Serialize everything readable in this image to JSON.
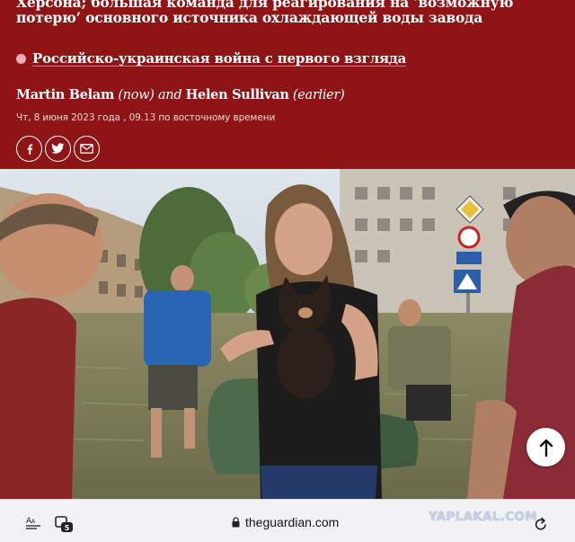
{
  "article": {
    "headline": "Херсона; большая команда для реагирования на ‘возможную потерю’ основного источника охлаждающей воды завода",
    "series_link": "Российско-украинская война с первого взгляда",
    "byline": {
      "author1": "Martin Belam",
      "author1_note": "(now)",
      "conjunction": "and",
      "author2": "Helen Sullivan",
      "author2_note": "(earlier)"
    },
    "dateline": "Чт, 8 июня 2023 года , 09.13 по восточному времени",
    "share": [
      "facebook",
      "twitter",
      "email"
    ]
  },
  "browser": {
    "url": "theguardian.com",
    "tab_count": "5",
    "watermark": "YAPLAKAL.COM"
  },
  "colors": {
    "header_bg": "#8f1416",
    "series_dot": "#f4a9b8",
    "browser_bg": "#f2f2f4"
  }
}
